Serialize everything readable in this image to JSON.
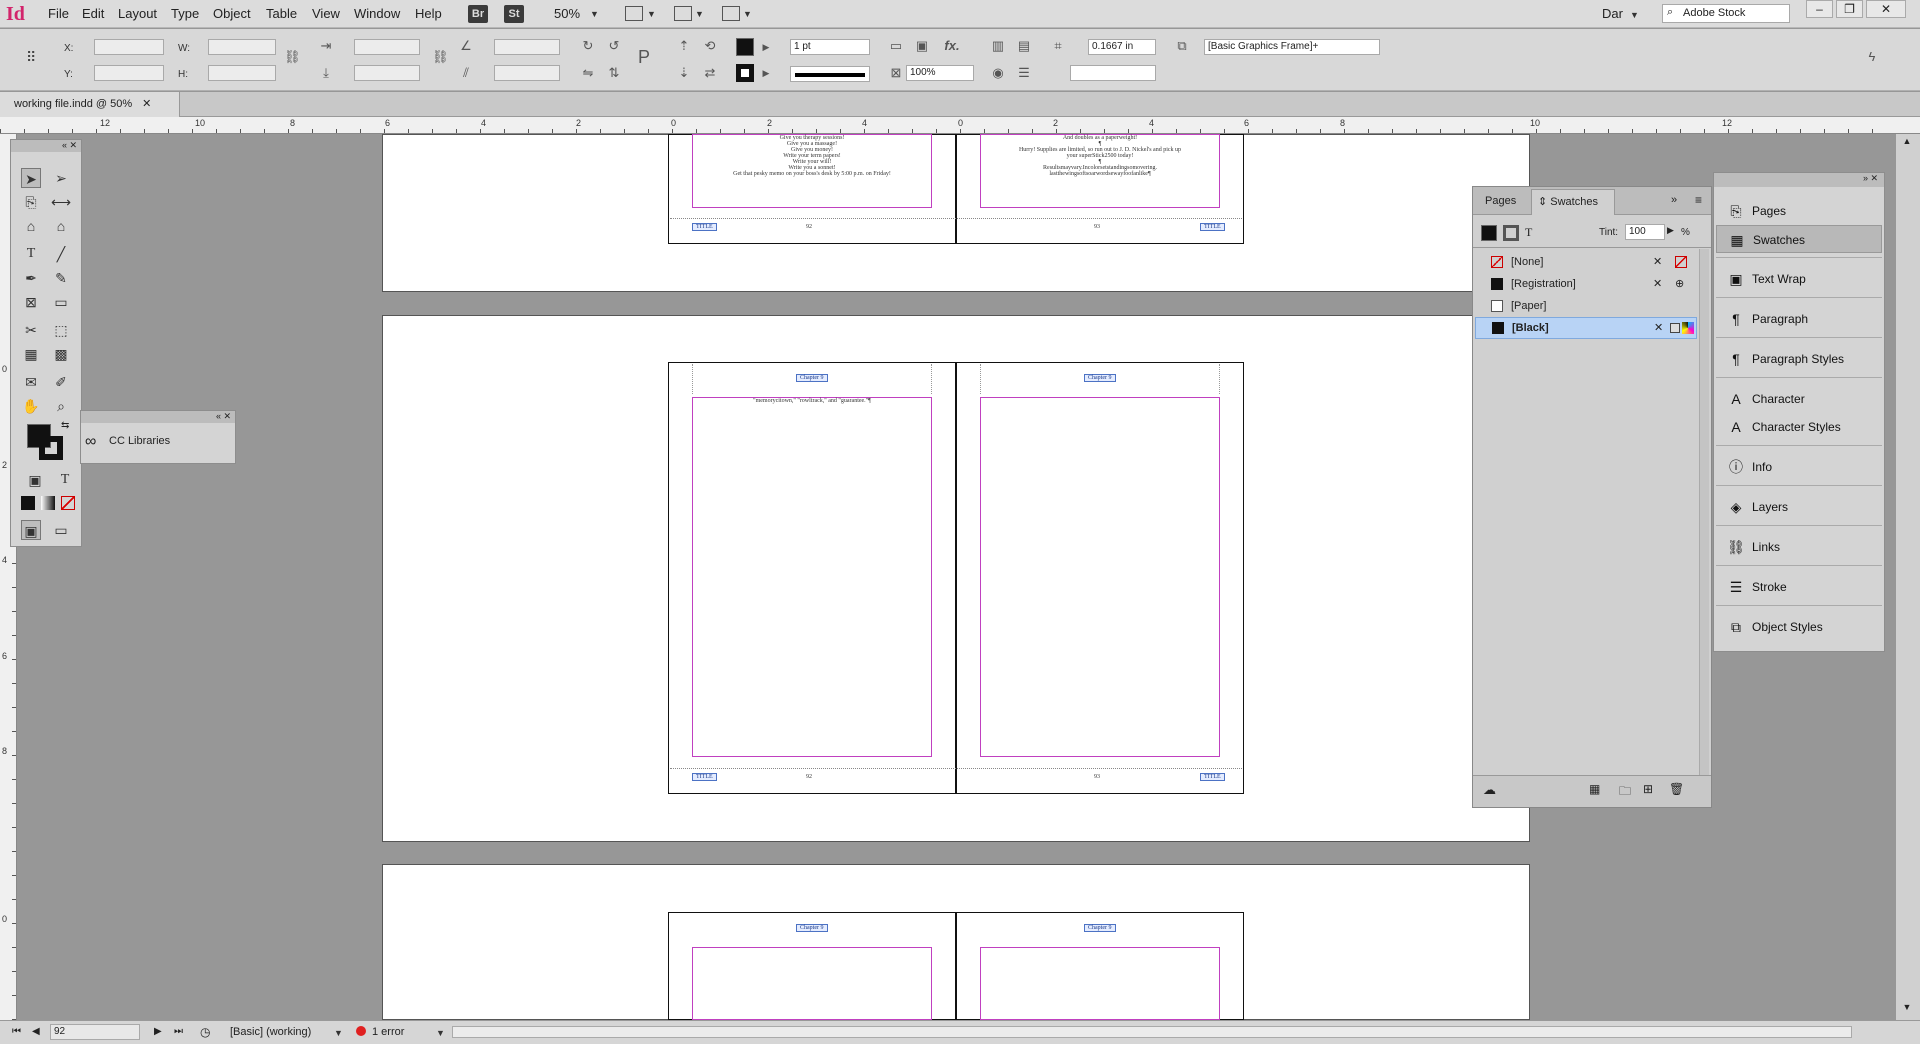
{
  "app": {
    "logo": "Id",
    "menus": [
      "File",
      "Edit",
      "Layout",
      "Type",
      "Object",
      "Table",
      "View",
      "Window",
      "Help"
    ],
    "bridge": "Br",
    "stock_btn": "St",
    "zoom": "50%",
    "user": "Dar",
    "search_placeholder": "Adobe Stock"
  },
  "control": {
    "x_label": "X:",
    "y_label": "Y:",
    "w_label": "W:",
    "h_label": "H:",
    "stroke_weight": "1 pt",
    "opacity": "100%",
    "offset": "0.1667 in",
    "object_style": "[Basic Graphics Frame]+"
  },
  "doc": {
    "tab_title": "working file.indd @ 50%"
  },
  "rulers": {
    "h_ticks": [
      "12",
      "10",
      "8",
      "6",
      "4",
      "2",
      "0",
      "2",
      "4",
      "0",
      "2",
      "4",
      "6",
      "8",
      "10",
      "12"
    ],
    "v_ticks": [
      "0",
      "2",
      "4",
      "6",
      "8",
      "0"
    ]
  },
  "pages": {
    "top_left_lines": [
      "Give you therapy sessions!",
      "Give you a massage!",
      "Give you money!",
      "Write your term papers!",
      "Write your will!",
      "Write you a sonnet!",
      "Get that pesky memo on your boss's desk by 5:00 p.m. on Friday!"
    ],
    "top_right_lines": [
      "And doubles as a paperweight!",
      "¶",
      "Hurry! Supplies are limited, so run out to J. D. Nickel's and pick up",
      "your superStick2500 today!",
      "¶",
      "Resultsmayvary.Incolorsetstandingsomovering.",
      "lastthewingsoftsoarwordsewayfoofanlike¶"
    ],
    "footer_label": "TITLE",
    "page_nums": [
      "92",
      "93"
    ],
    "chapter_label": "Chapter 9",
    "middle_text": "\"memorycitown,\" \"rowltrack,\" and \"guarantee.\"¶"
  },
  "toolbox": {
    "cc_libraries": "CC Libraries"
  },
  "swatches": {
    "tabs": [
      "Pages",
      "Swatches"
    ],
    "tint_label": "Tint:",
    "tint_value": "100",
    "pct": "%",
    "items": [
      {
        "name": "[None]",
        "color": "#ffffff"
      },
      {
        "name": "[Registration]",
        "color": "#111111"
      },
      {
        "name": "[Paper]",
        "color": "#ffffff"
      },
      {
        "name": "[Black]",
        "color": "#111111"
      }
    ]
  },
  "right_panel": {
    "items": [
      "Pages",
      "Swatches",
      "Text Wrap",
      "Paragraph",
      "Paragraph Styles",
      "Character",
      "Character Styles",
      "Info",
      "Layers",
      "Links",
      "Stroke",
      "Object Styles"
    ]
  },
  "status": {
    "page": "92",
    "master": "[Basic] (working)",
    "errors": "1 error"
  }
}
